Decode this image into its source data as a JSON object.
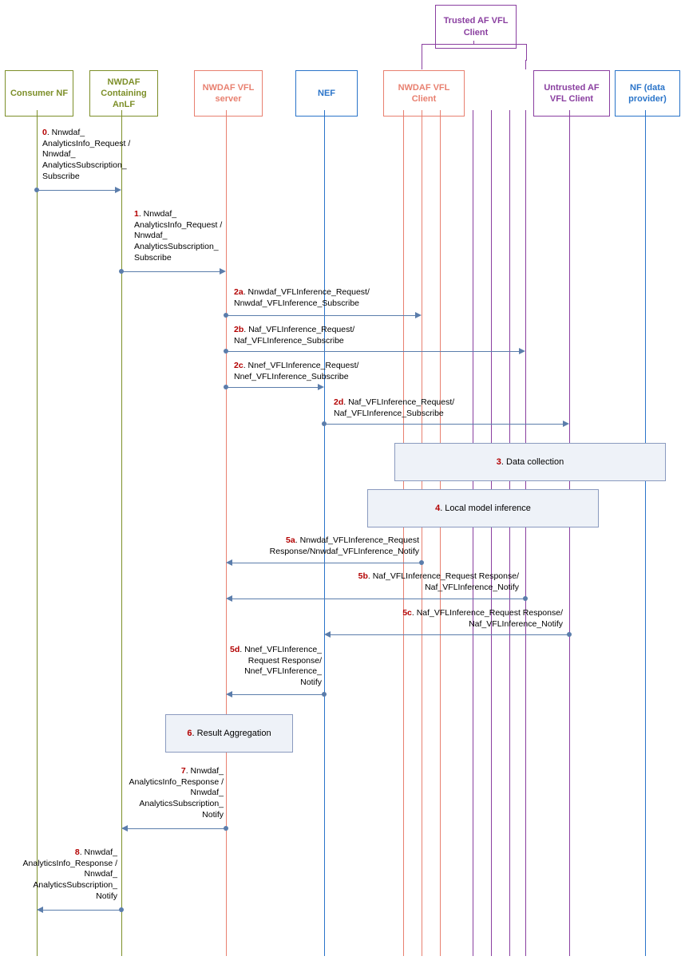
{
  "participants": {
    "consumer": "Consumer NF",
    "anlf": "NWDAF Containing AnLF",
    "vflserver": "NWDAF VFL server",
    "nef": "NEF",
    "vflclient": "NWDAF VFL Client",
    "trusted": "Trusted AF VFL Client",
    "untrusted": "Untrusted AF VFL Client",
    "nf": "NF (data provider)"
  },
  "messages": {
    "m0": {
      "num": "0",
      "text": ". Nnwdaf_\nAnalyticsInfo_Request /\nNnwdaf_\nAnalyticsSubscription_\nSubscribe"
    },
    "m1": {
      "num": "1",
      "text": ". Nnwdaf_\nAnalyticsInfo_Request /\nNnwdaf_\nAnalyticsSubscription_\nSubscribe"
    },
    "m2a": {
      "num": "2a",
      "text": ". Nnwdaf_VFLInference_Request/\nNnwdaf_VFLInference_Subscribe"
    },
    "m2b": {
      "num": "2b",
      "text": ". Naf_VFLInference_Request/\nNaf_VFLInference_Subscribe"
    },
    "m2c": {
      "num": "2c",
      "text": ". Nnef_VFLInference_Request/\nNnef_VFLInference_Subscribe"
    },
    "m2d": {
      "num": "2d",
      "text": ". Naf_VFLInference_Request/\nNaf_VFLInference_Subscribe"
    },
    "n3": {
      "num": "3",
      "text": ". Data collection"
    },
    "n4": {
      "num": "4",
      "text": ". Local model inference"
    },
    "m5a": {
      "num": "5a",
      "text": ". Nnwdaf_VFLInference_Request\nResponse/Nnwdaf_VFLInference_Notify"
    },
    "m5b": {
      "num": "5b",
      "text": ". Naf_VFLInference_Request Response/\nNaf_VFLInference_Notify"
    },
    "m5c": {
      "num": "5c",
      "text": ". Naf_VFLInference_Request Response/\nNaf_VFLInference_Notify"
    },
    "m5d": {
      "num": "5d",
      "text": ". Nnef_VFLInference_\nRequest Response/\nNnef_VFLInference_\nNotify"
    },
    "n6": {
      "num": "6",
      "text": ". Result Aggregation"
    },
    "m7": {
      "num": "7",
      "text": ". Nnwdaf_\nAnalyticsInfo_Response /\nNnwdaf_\nAnalyticsSubscription_\nNotify"
    },
    "m8": {
      "num": "8",
      "text": ". Nnwdaf_\nAnalyticsInfo_Response /\nNnwdaf_\nAnalyticsSubscription_\nNotify"
    }
  },
  "chart_data": {
    "type": "sequence-diagram",
    "participants": [
      {
        "id": "consumer",
        "label": "Consumer NF",
        "color": "olive"
      },
      {
        "id": "anlf",
        "label": "NWDAF Containing AnLF",
        "color": "olive"
      },
      {
        "id": "vflserver",
        "label": "NWDAF VFL server",
        "color": "salmon"
      },
      {
        "id": "nef",
        "label": "NEF",
        "color": "blue"
      },
      {
        "id": "vflclient",
        "label": "NWDAF VFL Client",
        "color": "salmon"
      },
      {
        "id": "trusted",
        "label": "Trusted AF VFL Client",
        "color": "purple",
        "group_of": [
          "vflclient",
          "trusted_leg_a",
          "trusted_leg_b"
        ]
      },
      {
        "id": "untrusted",
        "label": "Untrusted AF VFL Client",
        "color": "purple"
      },
      {
        "id": "nf",
        "label": "NF (data provider)",
        "color": "blue"
      }
    ],
    "messages": [
      {
        "step": "0",
        "from": "consumer",
        "to": "anlf",
        "dir": "right",
        "label": "Nnwdaf_AnalyticsInfo_Request / Nnwdaf_AnalyticsSubscription_Subscribe"
      },
      {
        "step": "1",
        "from": "anlf",
        "to": "vflserver",
        "dir": "right",
        "label": "Nnwdaf_AnalyticsInfo_Request / Nnwdaf_AnalyticsSubscription_Subscribe"
      },
      {
        "step": "2a",
        "from": "vflserver",
        "to": "vflclient",
        "dir": "right",
        "label": "Nnwdaf_VFLInference_Request / Nnwdaf_VFLInference_Subscribe"
      },
      {
        "step": "2b",
        "from": "vflserver",
        "to": "trusted",
        "dir": "right",
        "label": "Naf_VFLInference_Request / Naf_VFLInference_Subscribe"
      },
      {
        "step": "2c",
        "from": "vflserver",
        "to": "nef",
        "dir": "right",
        "label": "Nnef_VFLInference_Request / Nnef_VFLInference_Subscribe"
      },
      {
        "step": "2d",
        "from": "nef",
        "to": "untrusted",
        "dir": "right",
        "label": "Naf_VFLInference_Request / Naf_VFLInference_Subscribe"
      },
      {
        "step": "3",
        "type": "note",
        "over": [
          "vflclient",
          "nf"
        ],
        "label": "Data collection"
      },
      {
        "step": "4",
        "type": "note",
        "over": [
          "vflclient",
          "untrusted"
        ],
        "label": "Local model inference"
      },
      {
        "step": "5a",
        "from": "vflclient",
        "to": "vflserver",
        "dir": "left",
        "label": "Nnwdaf_VFLInference_Request Response / Nnwdaf_VFLInference_Notify"
      },
      {
        "step": "5b",
        "from": "trusted",
        "to": "vflserver",
        "dir": "left",
        "label": "Naf_VFLInference_Request Response / Naf_VFLInference_Notify"
      },
      {
        "step": "5c",
        "from": "untrusted",
        "to": "nef",
        "dir": "left",
        "label": "Naf_VFLInference_Request Response / Naf_VFLInference_Notify"
      },
      {
        "step": "5d",
        "from": "nef",
        "to": "vflserver",
        "dir": "left",
        "label": "Nnef_VFLInference_Request Response / Nnef_VFLInference_Notify"
      },
      {
        "step": "6",
        "type": "note",
        "over": [
          "vflserver"
        ],
        "label": "Result Aggregation"
      },
      {
        "step": "7",
        "from": "vflserver",
        "to": "anlf",
        "dir": "left",
        "label": "Nnwdaf_AnalyticsInfo_Response / Nnwdaf_AnalyticsSubscription_Notify"
      },
      {
        "step": "8",
        "from": "anlf",
        "to": "consumer",
        "dir": "left",
        "label": "Nnwdaf_AnalyticsInfo_Response / Nnwdaf_AnalyticsSubscription_Notify"
      }
    ]
  }
}
